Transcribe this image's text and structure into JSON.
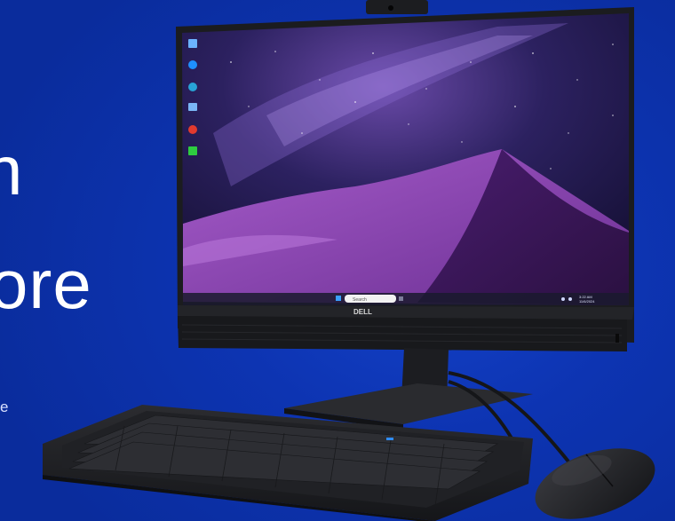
{
  "hero": {
    "headline_line1": "n",
    "headline_line2": "ore",
    "caption_fragment": "e"
  },
  "device": {
    "brand_logo": "DELL",
    "taskbar": {
      "search_placeholder": "Search",
      "clock_time": "3:22 AM",
      "clock_date": "11/6/2024"
    },
    "desktop_icons": [
      "recycle-bin-icon",
      "browser-icon",
      "edge-icon",
      "user-folder-icon",
      "antivirus-icon",
      "store-icon"
    ]
  },
  "colors": {
    "background": "#0b2fa6",
    "screen_sky": "#241a4d",
    "dune": "#7a3aa0",
    "hardware": "#1e1f22"
  }
}
